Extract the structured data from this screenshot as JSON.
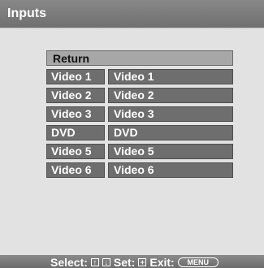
{
  "window": {
    "title": "Inputs"
  },
  "menu": {
    "return_label": "Return",
    "rows": [
      {
        "input": "Video 1",
        "name": "Video 1"
      },
      {
        "input": "Video 2",
        "name": "Video 2"
      },
      {
        "input": "Video 3",
        "name": "Video 3"
      },
      {
        "input": "DVD",
        "name": "DVD"
      },
      {
        "input": "Video 5",
        "name": "Video 5"
      },
      {
        "input": "Video 6",
        "name": "Video 6"
      }
    ]
  },
  "footer": {
    "select_label": "Select:",
    "set_label": "Set:",
    "exit_label": "Exit:",
    "menu_button_label": "MENU",
    "icons": [
      "up-arrow-key-icon",
      "down-arrow-key-icon",
      "set-key-icon"
    ]
  },
  "colors": {
    "header": "#7a7a7a",
    "background": "#e2e2e2",
    "cell": "#6e6e6e",
    "return_row": "#a7a7a7"
  }
}
